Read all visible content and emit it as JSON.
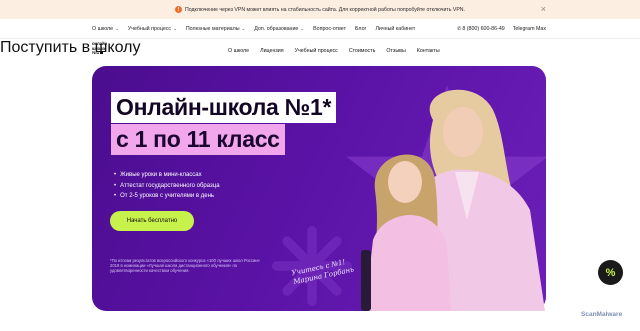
{
  "alert": {
    "text": "Подключение через VPN может влиять на стабильность сайта. Для корректной работы попробуйте отключить VPN.",
    "warn_icon": "!",
    "close_icon": "×"
  },
  "topbar": {
    "items": [
      "О школе",
      "Учебный процесс",
      "Полезные материалы",
      "Доп. образование",
      "Вопрос-ответ",
      "Блог",
      "Личный кабинет"
    ],
    "dropdown_flags": [
      true,
      true,
      true,
      true,
      false,
      false,
      false
    ],
    "chevron": "⌄",
    "phone": "8 (800) 600-86-49",
    "telegram": "Telegram Max"
  },
  "nav": {
    "logo_line1": "онлайн",
    "logo_line2": "школа",
    "logo_line3": "№1",
    "links": [
      "О школе",
      "Лицензия",
      "Учебный процесс",
      "Стоимость",
      "Отзывы",
      "Контакты"
    ],
    "cta": "Поступить в школу"
  },
  "hero": {
    "title_line1": "Онлайн-школа №1*",
    "title_line2": "с 1 по 11 класс",
    "bullets": [
      "Живые уроки в мини-классах",
      "Аттестат государственного образца",
      "От 2-5 уроков с учителями в день"
    ],
    "start_button": "Начать бесплатно",
    "footnote": "*По итогам результатов всероссийского конкурса «100 лучших школ России» 2019 в номинации «Лучшая школа дистанционного обучения» по удовлетворенности качеством обучения.",
    "signature": "Учитесь с №1! Марина Горбань"
  },
  "fab_icon": "%",
  "watermark": "ScanMalware",
  "colors": {
    "hero_bg": "#5a12a5",
    "title2_bg": "#f2a6ec",
    "accent_lime": "#c7f24b",
    "alert_bg": "#fdeee2",
    "warn_orange": "#ef6c2d"
  }
}
